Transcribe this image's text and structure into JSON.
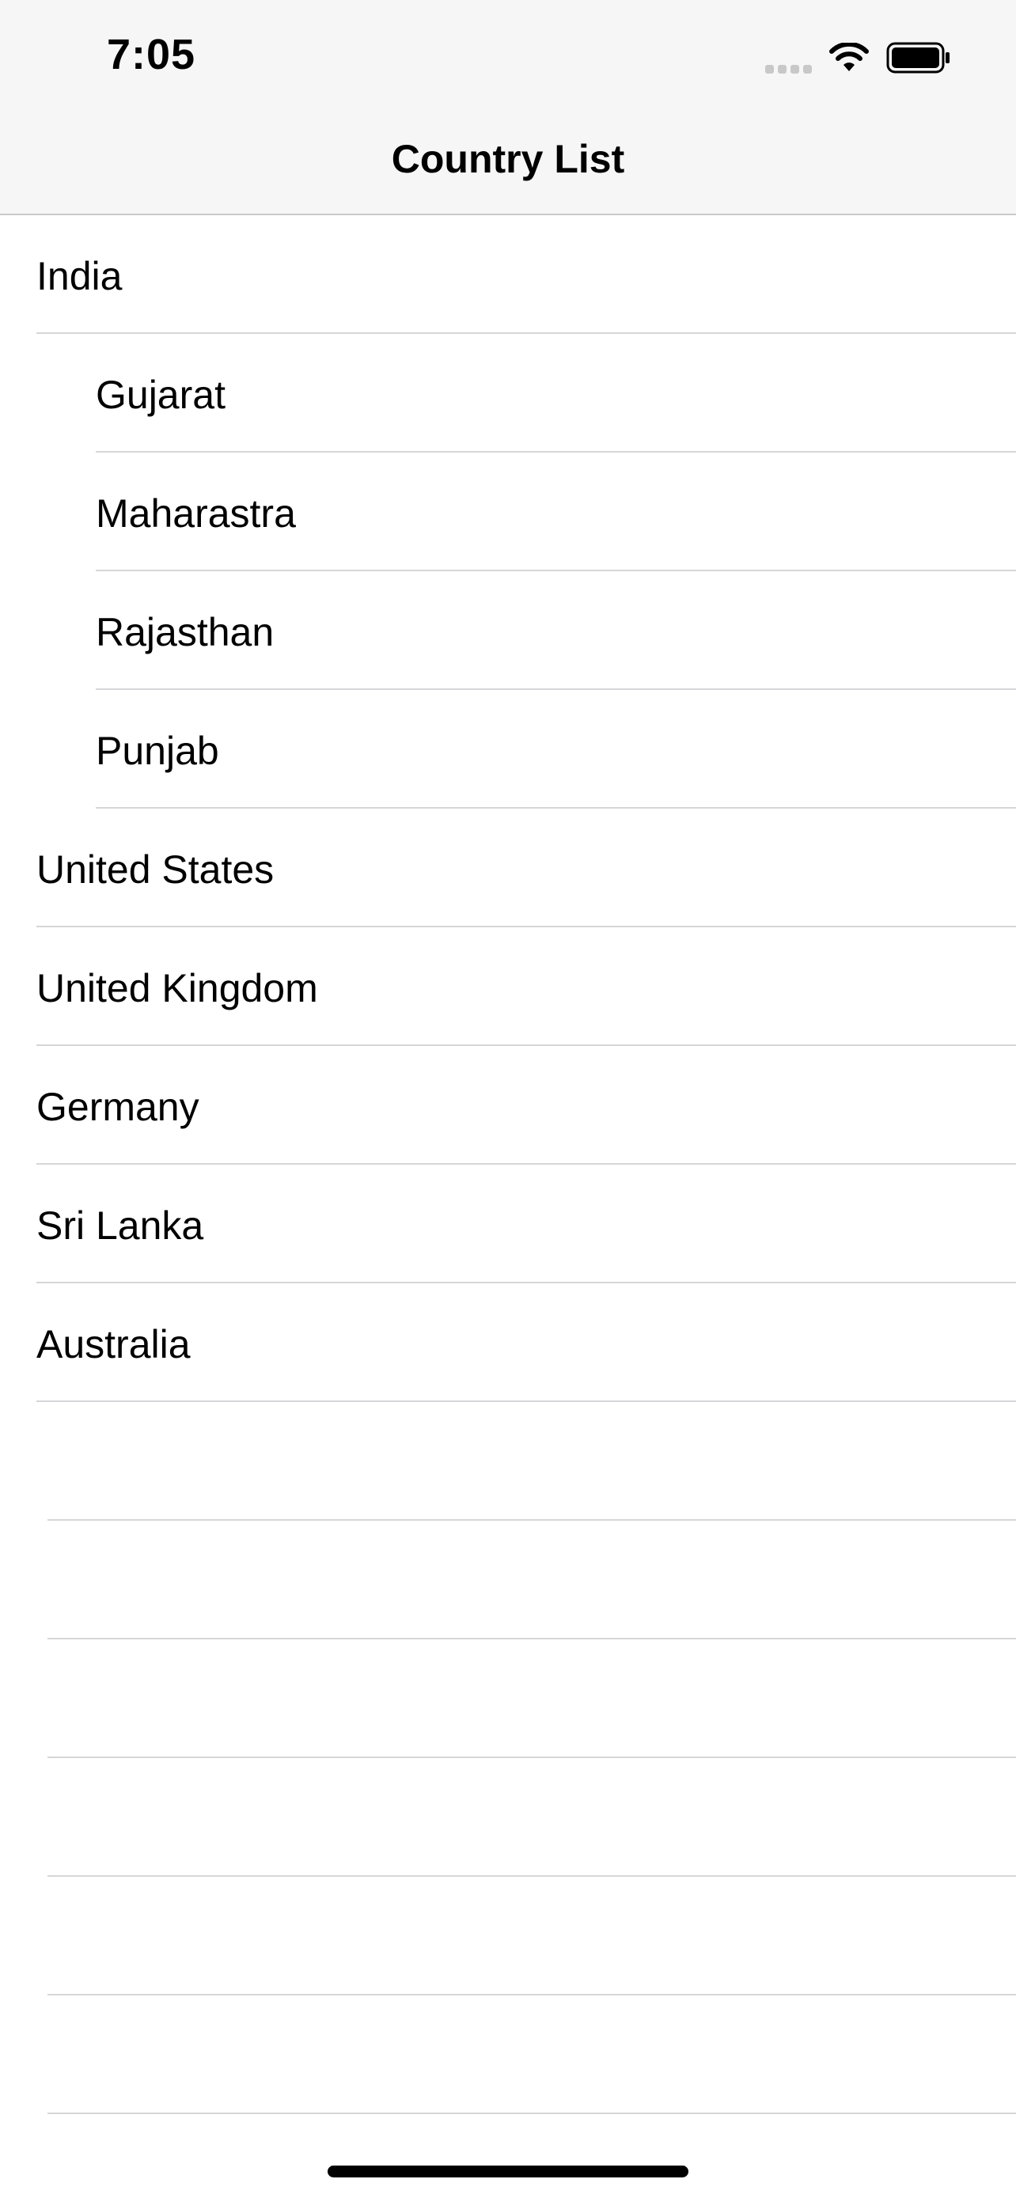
{
  "status_bar": {
    "time": "7:05",
    "icons": [
      "cellular-signal-icon",
      "wifi-icon",
      "battery-icon"
    ]
  },
  "nav": {
    "title": "Country List"
  },
  "list": {
    "rows": [
      {
        "label": "India",
        "level": "country"
      },
      {
        "label": "Gujarat",
        "level": "state"
      },
      {
        "label": "Maharastra",
        "level": "state"
      },
      {
        "label": "Rajasthan",
        "level": "state"
      },
      {
        "label": "Punjab",
        "level": "state"
      },
      {
        "label": "United States",
        "level": "country"
      },
      {
        "label": "United Kingdom",
        "level": "country"
      },
      {
        "label": "Germany",
        "level": "country"
      },
      {
        "label": "Sri Lanka",
        "level": "country"
      },
      {
        "label": "Australia",
        "level": "country"
      }
    ]
  },
  "colors": {
    "bar_background": "#f6f6f6",
    "separator": "#d6d6d9",
    "text": "#000000"
  }
}
